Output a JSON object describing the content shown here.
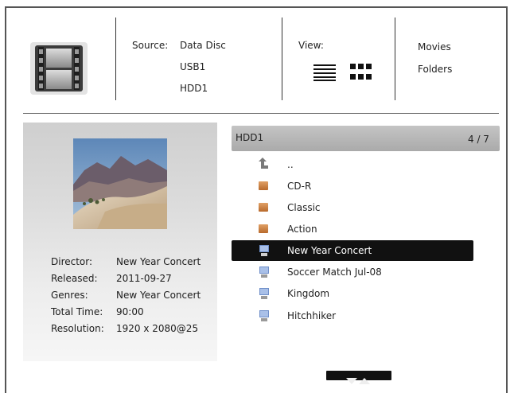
{
  "source": {
    "label": "Source:",
    "items": [
      "Data Disc",
      "USB1",
      "HDD1"
    ]
  },
  "view": {
    "label": "View:",
    "icons": [
      "list-view-icon",
      "grid-view-icon"
    ]
  },
  "mode": {
    "items": [
      "Movies",
      "Folders"
    ]
  },
  "details": {
    "director_label": "Director:",
    "director_value": "New Year Concert",
    "released_label": "Released:",
    "released_value": "2011-09-27",
    "genres_label": "Genres:",
    "genres_value": "New Year Concert",
    "total_time_label": "Total Time:",
    "total_time_value": "90:00",
    "resolution_label": "Resolution:",
    "resolution_value": "1920 x 2080@25"
  },
  "list": {
    "title": "HDD1",
    "position": "4 / 7",
    "items": [
      {
        "label": "..",
        "icon": "up-arrow-icon"
      },
      {
        "label": "CD-R",
        "icon": "folder-icon"
      },
      {
        "label": "Classic",
        "icon": "folder-icon"
      },
      {
        "label": "Action",
        "icon": "folder-icon"
      },
      {
        "label": "New Year Concert",
        "icon": "video-file-icon",
        "selected": true
      },
      {
        "label": "Soccer Match Jul-08",
        "icon": "video-file-icon"
      },
      {
        "label": "Kingdom",
        "icon": "video-file-icon"
      },
      {
        "label": "Hitchhiker",
        "icon": "video-file-icon"
      }
    ]
  },
  "colors": {
    "selected_bg": "#111111",
    "folder": "#d08a4c",
    "header_bar": "#b4b4b4"
  }
}
